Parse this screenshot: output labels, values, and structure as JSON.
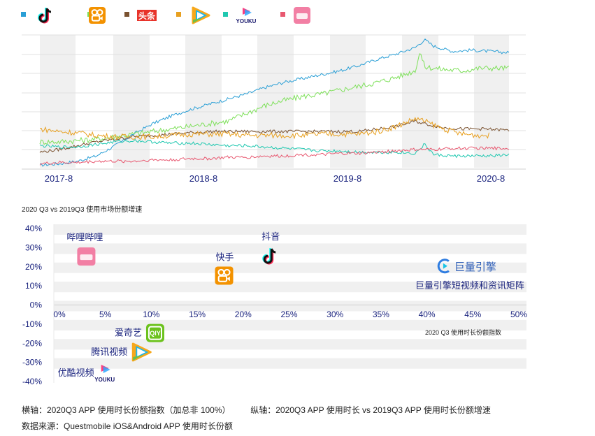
{
  "legend": [
    {
      "icon": "tiktok-icon",
      "color": "#2a9fd6"
    },
    {
      "icon": "kuaishou-icon",
      "color": "#7ee05a"
    },
    {
      "icon": "toutiao-icon",
      "label": "头条",
      "color": "#7a5230"
    },
    {
      "icon": "tencent-video-icon",
      "color": "#e8a020"
    },
    {
      "icon": "youku-icon",
      "label": "YOUKU",
      "color": "#20c8b0"
    },
    {
      "icon": "bilibili-icon",
      "label": "bilibili",
      "color": "#e85870"
    }
  ],
  "top_chart": {
    "type": "line",
    "x_ticks": [
      "2017-8",
      "2018-8",
      "2019-8",
      "2020-8"
    ],
    "x_range": [
      "2017-7",
      "2020-9"
    ],
    "y_range": [
      0,
      100
    ],
    "grid": true,
    "series": [
      {
        "key": "douyin",
        "color": "#2a9fd6",
        "points": [
          [
            0,
            2
          ],
          [
            0.04,
            3
          ],
          [
            0.08,
            5
          ],
          [
            0.12,
            9
          ],
          [
            0.16,
            17
          ],
          [
            0.2,
            26
          ],
          [
            0.24,
            34
          ],
          [
            0.28,
            40
          ],
          [
            0.32,
            45
          ],
          [
            0.36,
            49
          ],
          [
            0.4,
            53
          ],
          [
            0.44,
            57
          ],
          [
            0.48,
            62
          ],
          [
            0.52,
            66
          ],
          [
            0.56,
            69
          ],
          [
            0.6,
            72
          ],
          [
            0.64,
            75
          ],
          [
            0.68,
            79
          ],
          [
            0.72,
            84
          ],
          [
            0.76,
            88
          ],
          [
            0.8,
            93
          ],
          [
            0.82,
            99
          ],
          [
            0.84,
            94
          ],
          [
            0.88,
            90
          ],
          [
            0.92,
            91
          ],
          [
            0.96,
            90
          ],
          [
            1.0,
            89
          ]
        ]
      },
      {
        "key": "kuaishou",
        "color": "#7ee05a",
        "points": [
          [
            0,
            20
          ],
          [
            0.04,
            20
          ],
          [
            0.08,
            21
          ],
          [
            0.12,
            22
          ],
          [
            0.16,
            24
          ],
          [
            0.2,
            26
          ],
          [
            0.24,
            28
          ],
          [
            0.28,
            30
          ],
          [
            0.32,
            32
          ],
          [
            0.36,
            34
          ],
          [
            0.4,
            36
          ],
          [
            0.44,
            42
          ],
          [
            0.48,
            48
          ],
          [
            0.52,
            52
          ],
          [
            0.56,
            55
          ],
          [
            0.6,
            57
          ],
          [
            0.64,
            60
          ],
          [
            0.68,
            63
          ],
          [
            0.72,
            66
          ],
          [
            0.76,
            70
          ],
          [
            0.8,
            75
          ],
          [
            0.81,
            90
          ],
          [
            0.82,
            78
          ],
          [
            0.86,
            76
          ],
          [
            0.9,
            75
          ],
          [
            0.94,
            77
          ],
          [
            1.0,
            77
          ]
        ]
      },
      {
        "key": "toutiao",
        "color": "#7a5230",
        "points": [
          [
            0,
            12
          ],
          [
            0.04,
            14
          ],
          [
            0.08,
            17
          ],
          [
            0.12,
            20
          ],
          [
            0.16,
            22
          ],
          [
            0.2,
            24
          ],
          [
            0.24,
            25
          ],
          [
            0.28,
            26
          ],
          [
            0.32,
            27
          ],
          [
            0.36,
            28
          ],
          [
            0.4,
            28
          ],
          [
            0.44,
            28
          ],
          [
            0.48,
            28
          ],
          [
            0.52,
            28
          ],
          [
            0.56,
            28
          ],
          [
            0.6,
            28
          ],
          [
            0.64,
            28
          ],
          [
            0.68,
            28
          ],
          [
            0.72,
            30
          ],
          [
            0.76,
            32
          ],
          [
            0.8,
            36
          ],
          [
            0.82,
            34
          ],
          [
            0.86,
            31
          ],
          [
            0.9,
            30
          ],
          [
            0.94,
            30
          ],
          [
            1.0,
            29
          ]
        ]
      },
      {
        "key": "tencent_video",
        "color": "#e8a020",
        "points": [
          [
            0,
            30
          ],
          [
            0.04,
            28
          ],
          [
            0.08,
            27
          ],
          [
            0.12,
            25
          ],
          [
            0.16,
            24
          ],
          [
            0.2,
            24
          ],
          [
            0.24,
            24
          ],
          [
            0.28,
            25
          ],
          [
            0.32,
            26
          ],
          [
            0.36,
            26
          ],
          [
            0.4,
            26
          ],
          [
            0.44,
            25
          ],
          [
            0.48,
            25
          ],
          [
            0.52,
            25
          ],
          [
            0.56,
            25
          ],
          [
            0.6,
            26
          ],
          [
            0.64,
            26
          ],
          [
            0.68,
            26
          ],
          [
            0.72,
            28
          ],
          [
            0.76,
            32
          ],
          [
            0.8,
            38
          ],
          [
            0.82,
            36
          ],
          [
            0.86,
            30
          ],
          [
            0.9,
            26
          ],
          [
            0.94,
            25
          ],
          [
            0.96,
            25
          ]
        ]
      },
      {
        "key": "youku",
        "color": "#20c8b0",
        "points": [
          [
            0,
            17
          ],
          [
            0.04,
            16
          ],
          [
            0.08,
            16
          ],
          [
            0.12,
            18
          ],
          [
            0.16,
            20
          ],
          [
            0.2,
            21
          ],
          [
            0.24,
            20
          ],
          [
            0.28,
            19
          ],
          [
            0.32,
            19
          ],
          [
            0.36,
            18
          ],
          [
            0.4,
            17
          ],
          [
            0.44,
            17
          ],
          [
            0.48,
            16
          ],
          [
            0.52,
            15
          ],
          [
            0.56,
            14
          ],
          [
            0.6,
            13
          ],
          [
            0.64,
            13
          ],
          [
            0.68,
            12
          ],
          [
            0.72,
            12
          ],
          [
            0.76,
            12
          ],
          [
            0.8,
            11
          ],
          [
            0.82,
            18
          ],
          [
            0.84,
            10
          ],
          [
            0.88,
            9
          ],
          [
            0.92,
            9
          ],
          [
            0.96,
            9
          ],
          [
            1.0,
            10
          ]
        ]
      },
      {
        "key": "bilibili",
        "color": "#e85870",
        "points": [
          [
            0,
            3
          ],
          [
            0.04,
            4
          ],
          [
            0.08,
            4
          ],
          [
            0.12,
            5
          ],
          [
            0.16,
            5
          ],
          [
            0.2,
            5
          ],
          [
            0.24,
            6
          ],
          [
            0.28,
            6
          ],
          [
            0.32,
            7
          ],
          [
            0.36,
            7
          ],
          [
            0.4,
            8
          ],
          [
            0.44,
            8
          ],
          [
            0.48,
            9
          ],
          [
            0.52,
            9
          ],
          [
            0.56,
            10
          ],
          [
            0.6,
            10
          ],
          [
            0.64,
            11
          ],
          [
            0.68,
            11
          ],
          [
            0.72,
            12
          ],
          [
            0.76,
            13
          ],
          [
            0.8,
            14
          ],
          [
            0.84,
            14
          ],
          [
            0.88,
            15
          ],
          [
            0.92,
            15
          ],
          [
            0.96,
            15
          ],
          [
            1.0,
            15
          ]
        ]
      }
    ]
  },
  "bottom_chart": {
    "type": "scatter",
    "title": "2020 Q3 vs 2019Q3 使用市场份额增速",
    "xlabel": "2020 Q3 使用时长份额指数",
    "x_ticks": [
      "0%",
      "5%",
      "10%",
      "15%",
      "20%",
      "25%",
      "30%",
      "35%",
      "40%",
      "45%",
      "50%"
    ],
    "y_ticks": [
      "40%",
      "30%",
      "20%",
      "10%",
      "0%",
      "-10%",
      "-20%",
      "-30%",
      "-40%"
    ],
    "xlim": [
      0,
      50
    ],
    "ylim": [
      -40,
      40
    ],
    "points": [
      {
        "name": "哔哩哔哩",
        "icon": "bilibili-icon",
        "x": 3,
        "y": 25
      },
      {
        "name": "快手",
        "icon": "kuaishou-icon",
        "x": 18,
        "y": 15
      },
      {
        "name": "抖音",
        "icon": "tiktok-icon",
        "x": 23,
        "y": 25
      },
      {
        "name": "巨量引擎短视频和资讯矩阵",
        "icon": "ocean-engine-icon",
        "brand": "巨量引擎",
        "x": 42,
        "y": 20
      },
      {
        "name": "爱奇艺",
        "icon": "iqiyi-icon",
        "badge": "QIY",
        "x": 10.5,
        "y": -15
      },
      {
        "name": "腾讯视频",
        "icon": "tencent-video-icon",
        "x": 9,
        "y": -25
      },
      {
        "name": "优酷视频",
        "icon": "youku-icon",
        "x": 5,
        "y": -36
      }
    ]
  },
  "captions": {
    "x_axis_note": "横轴：2020Q3 APP 使用时长份额指数（加总非 100%）",
    "y_axis_note": "纵轴：2020Q3 APP 使用时长 vs 2019Q3 APP 使用时长份额增速",
    "source": "数据来源：Questmobile iOS&Android APP 使用时长份额"
  },
  "colors": {
    "axis_text": "#1a237e",
    "band": "#f0f0f0"
  }
}
